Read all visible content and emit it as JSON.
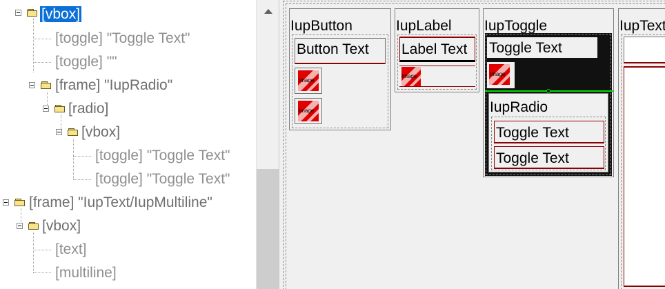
{
  "tree": {
    "nodes": [
      {
        "id": "vbox-root",
        "text": "[vbox]",
        "selected": true
      },
      {
        "id": "toggle-1",
        "text": "[toggle] \"Toggle Text\""
      },
      {
        "id": "toggle-2",
        "text": "[toggle] \"\""
      },
      {
        "id": "frame-iupradio",
        "text": "[frame] \"IupRadio\""
      },
      {
        "id": "radio",
        "text": "[radio]"
      },
      {
        "id": "vbox-radio",
        "text": "[vbox]"
      },
      {
        "id": "toggle-3",
        "text": "[toggle] \"Toggle Text\""
      },
      {
        "id": "toggle-4",
        "text": "[toggle] \"Toggle Text\""
      },
      {
        "id": "frame-iuptext",
        "text": "[frame] \"IupText/IupMultiline\""
      },
      {
        "id": "vbox-text",
        "text": "[vbox]"
      },
      {
        "id": "text",
        "text": "[text]"
      },
      {
        "id": "multiline",
        "text": "[multiline]"
      }
    ]
  },
  "preview": {
    "frames": {
      "button": {
        "title": "IupButton",
        "button_label": "Button Text",
        "image_label": "Image"
      },
      "label": {
        "title": "IupLabel",
        "label_text": "Label Text",
        "image_label": "Image"
      },
      "toggle": {
        "title": "IupToggle",
        "toggle_text": "Toggle Text",
        "image_label": "Image",
        "radio_title": "IupRadio",
        "radio_toggle_1": "Toggle Text",
        "radio_toggle_2": "Toggle Text"
      },
      "text": {
        "title": "IupText/IupMultiline"
      }
    }
  },
  "colors": {
    "selection": "#0a6fd7",
    "image_red": "#e00000",
    "highlight_green": "#00dd00",
    "border_red": "#8b0000"
  },
  "icons": {
    "expander": "minus-box-icon",
    "folder": "folder-icon",
    "scroll_up": "scroll-up-arrow-icon"
  }
}
